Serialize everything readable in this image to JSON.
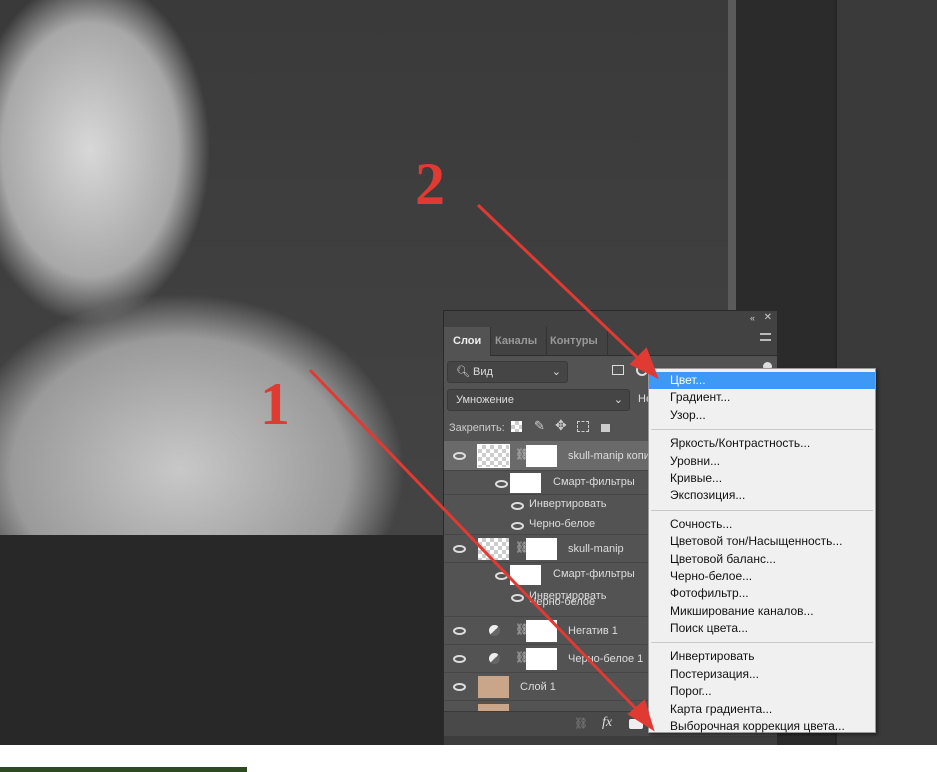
{
  "panel": {
    "tabs": [
      "Слои",
      "Каналы",
      "Контуры"
    ],
    "active_tab": "Слои",
    "filter_value": "Вид",
    "blend_mode": "Умножение",
    "opacity_label_partial": "Не",
    "lock_label": "Закрепить:",
    "layers": [
      {
        "name": "skull-manip копия",
        "type": "smart",
        "selected": true,
        "filters_label": "Смарт-фильтры",
        "filters": [
          "Инвертировать",
          "Черно-белое"
        ]
      },
      {
        "name": "skull-manip",
        "type": "smart",
        "filters_label": "Смарт-фильтры",
        "filters": [
          "Инвертировать",
          "Черно-белое"
        ]
      },
      {
        "name": "Негатив 1",
        "type": "adjustment"
      },
      {
        "name": "Черно-белое 1",
        "type": "adjustment"
      },
      {
        "name": "Слой 1",
        "type": "pixel"
      }
    ],
    "bottom_icons": [
      "link-icon",
      "fx-icon",
      "mask-icon",
      "adjustment-icon",
      "group-icon",
      "new-layer-icon",
      "trash-icon"
    ],
    "fx_label": "fx"
  },
  "menu": {
    "groups": [
      [
        "Цвет...",
        "Градиент...",
        "Узор..."
      ],
      [
        "Яркость/Контрастность...",
        "Уровни...",
        "Кривые...",
        "Экспозиция..."
      ],
      [
        "Сочность...",
        "Цветовой тон/Насыщенность...",
        "Цветовой баланс...",
        "Черно-белое...",
        "Фотофильтр...",
        "Микширование каналов...",
        "Поиск цвета..."
      ],
      [
        "Инвертировать",
        "Постеризация...",
        "Порог...",
        "Карта градиента...",
        "Выборочная коррекция цвета..."
      ]
    ],
    "selected": "Цвет..."
  },
  "annotations": {
    "one": "1",
    "two": "2",
    "color": "#e03a32"
  },
  "colors": {
    "menu_highlight": "#3d99f5",
    "panel_bg": "#535353"
  }
}
